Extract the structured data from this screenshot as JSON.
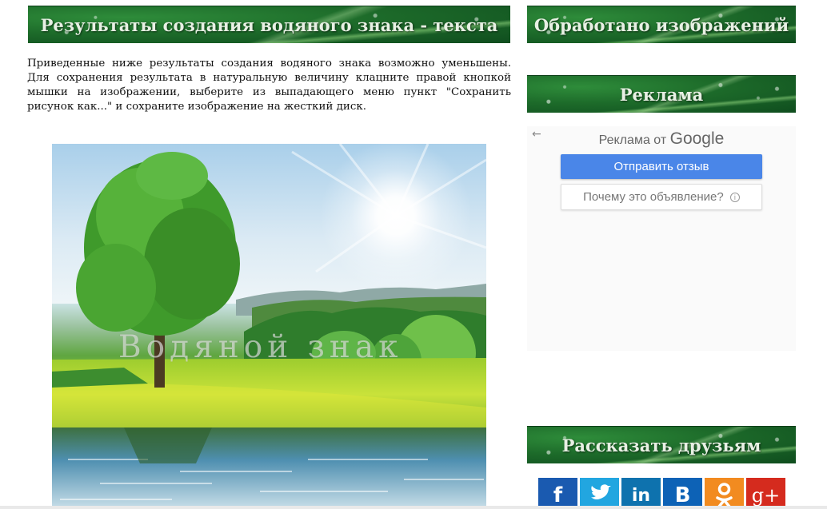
{
  "main": {
    "title": "Результаты создания водяного знака - текста",
    "intro": "Приведенные ниже результаты создания водяного знака возможно уменьшены. Для сохранения результата в натуральную величину клацните правой кнопкой мышки на изображении, выберите из выпадающего меню пункт \"Сохранить рисунок как...\" и сохраните изображение на жесткий диск.",
    "watermark_text": "Водяной знак"
  },
  "sidebar": {
    "processed_title": "Обработано изображений",
    "ads_title": "Реклама",
    "ad_widget": {
      "ads_by_prefix": "Реклама от",
      "ads_by_brand": "Google",
      "send_feedback": "Отправить отзыв",
      "why_this_ad": "Почему это объявление?",
      "back_glyph": "←",
      "info_glyph": "i"
    },
    "share_title": "Рассказать друзьям",
    "social": [
      {
        "icon": "facebook-icon",
        "glyph": "f",
        "color": "#1a5ab0"
      },
      {
        "icon": "twitter-icon",
        "glyph": "🐦",
        "color": "#22a6e0"
      },
      {
        "icon": "linkedin-icon",
        "glyph": "in",
        "color": "#0e72ae"
      },
      {
        "icon": "vk-icon",
        "glyph": "B",
        "color": "#0d62b6"
      },
      {
        "icon": "odnoklassniki-icon",
        "glyph": "ok",
        "color": "#f28b20"
      },
      {
        "icon": "google-plus-icon",
        "glyph": "g+",
        "color": "#d52b1e"
      }
    ]
  },
  "colors": {
    "banner_green": "#1d6b2a",
    "banner_text": "#e8f0e4",
    "ad_button_blue": "#4a86e8"
  }
}
